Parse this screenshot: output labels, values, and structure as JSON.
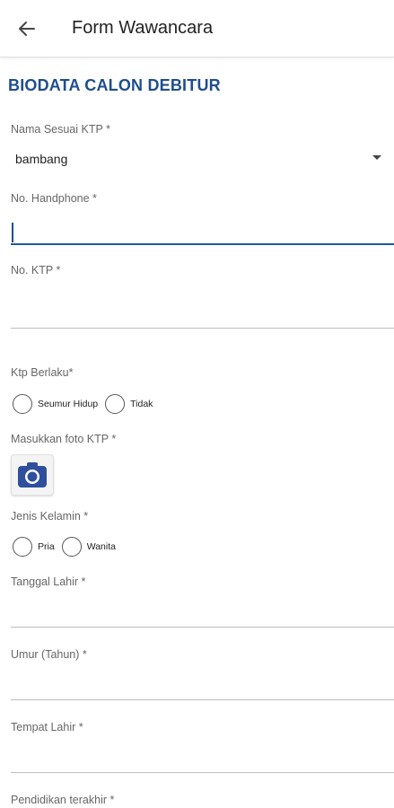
{
  "header": {
    "title": "Form Wawancara",
    "back_icon": "arrow-left-icon"
  },
  "section": {
    "title": "BIODATA CALON DEBITUR"
  },
  "fields": {
    "nama": {
      "label": "Nama Sesuai KTP *",
      "value": "bambang"
    },
    "handphone": {
      "label": "No. Handphone *",
      "value": ""
    },
    "ktp": {
      "label": "No. KTP *",
      "value": ""
    },
    "ktp_berlaku": {
      "label": "Ktp Berlaku*",
      "options": [
        "Seumur Hidup",
        "Tidak"
      ]
    },
    "foto_ktp": {
      "label": "Masukkan foto KTP *",
      "icon": "camera-icon"
    },
    "jenis_kelamin": {
      "label": "Jenis Kelamin *",
      "options": [
        "Pria",
        "Wanita"
      ]
    },
    "tanggal_lahir": {
      "label": "Tanggal Lahir *",
      "value": ""
    },
    "umur": {
      "label": "Umur (Tahun) *",
      "value": ""
    },
    "tempat_lahir": {
      "label": "Tempat Lahir *",
      "value": ""
    },
    "pendidikan": {
      "label": "Pendidikan terakhir *"
    }
  },
  "colors": {
    "accent": "#1f4e8c",
    "camera": "#2f4f9c"
  }
}
